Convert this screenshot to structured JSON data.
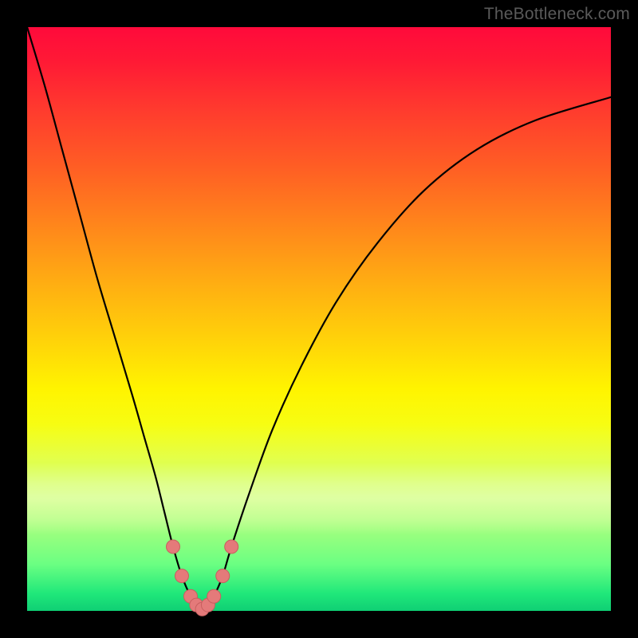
{
  "watermark": "TheBottleneck.com",
  "colors": {
    "frame": "#000000",
    "curve": "#000000",
    "marker_fill": "#e47a7a",
    "marker_stroke": "#c85f5f",
    "gradient_top": "#ff0a3b",
    "gradient_bottom": "#0fcf74"
  },
  "chart_data": {
    "type": "line",
    "title": "",
    "xlabel": "",
    "ylabel": "",
    "xlim": [
      0,
      100
    ],
    "ylim": [
      0,
      100
    ],
    "grid": false,
    "legend": false,
    "series": [
      {
        "name": "bottleneck-curve",
        "x": [
          0,
          3,
          6,
          9,
          12,
          15,
          18,
          20,
          22,
          23.5,
          25,
          26.5,
          28,
          29,
          30,
          31,
          32,
          33.5,
          35,
          38,
          42,
          47,
          53,
          60,
          68,
          77,
          87,
          100
        ],
        "y": [
          100,
          90,
          79,
          68,
          57,
          47,
          37,
          30,
          23,
          17,
          11,
          6,
          2.5,
          1,
          0.3,
          1,
          2.5,
          6,
          11,
          20,
          31,
          42,
          53,
          63,
          72,
          79,
          84,
          88
        ]
      }
    ],
    "markers": [
      {
        "x": 25.0,
        "y": 11
      },
      {
        "x": 26.5,
        "y": 6
      },
      {
        "x": 28.0,
        "y": 2.5
      },
      {
        "x": 29.0,
        "y": 1
      },
      {
        "x": 30.0,
        "y": 0.3
      },
      {
        "x": 31.0,
        "y": 1
      },
      {
        "x": 32.0,
        "y": 2.5
      },
      {
        "x": 33.5,
        "y": 6
      },
      {
        "x": 35.0,
        "y": 11
      }
    ]
  }
}
